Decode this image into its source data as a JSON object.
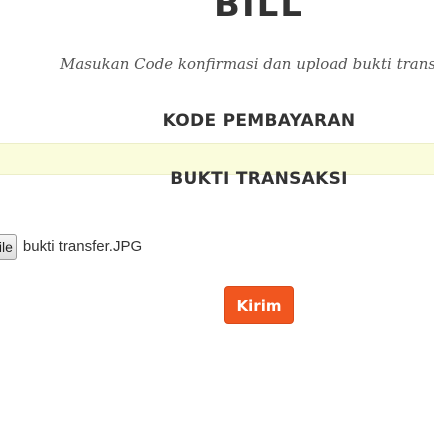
{
  "header": {
    "title": "BILL"
  },
  "instruction": "Masukan Code konfirmasi dan upload bukti transaksi",
  "payment_code": {
    "heading": "KODE PEMBAYARAN",
    "value": "",
    "placeholder": ""
  },
  "proof": {
    "heading": "BUKTI TRANSAKSI",
    "file_button_label": "Choose File",
    "file_name": "bukti transfer.JPG"
  },
  "submit": {
    "label": "Kirim"
  },
  "colors": {
    "submit_bg": "#f1561f",
    "input_bg": "#fafcdc",
    "text": "#333333"
  }
}
